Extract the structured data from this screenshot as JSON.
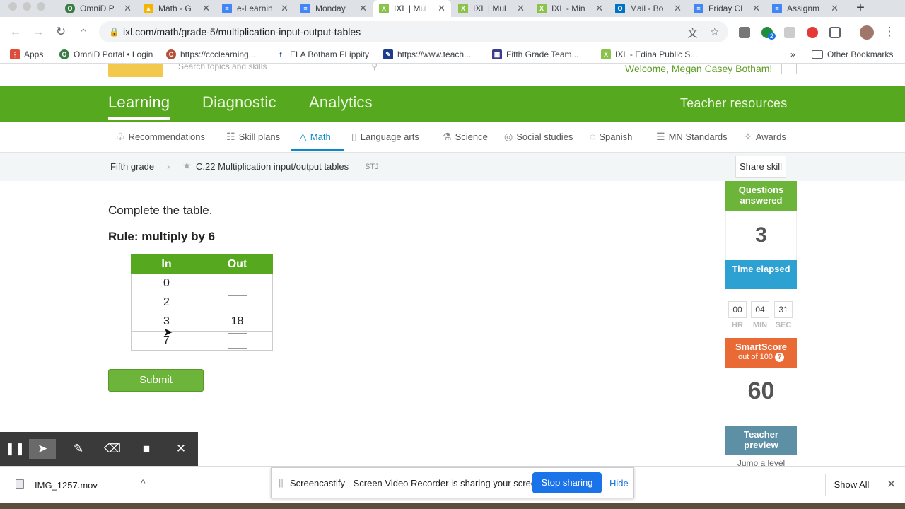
{
  "browser": {
    "tabs": [
      {
        "title": "OmniD P",
        "icon": "omnid-icon"
      },
      {
        "title": "Math - G",
        "icon": "drive-icon"
      },
      {
        "title": "e-Learnin",
        "icon": "docs-icon"
      },
      {
        "title": "Monday",
        "icon": "docs-icon"
      },
      {
        "title": "IXL | Mul",
        "icon": "ixl-icon",
        "active": true
      },
      {
        "title": "IXL | Mul",
        "icon": "ixl-icon"
      },
      {
        "title": "IXL - Min",
        "icon": "ixl-icon"
      },
      {
        "title": "Mail - Bo",
        "icon": "outlook-icon"
      },
      {
        "title": "Friday Cl",
        "icon": "docs-icon"
      },
      {
        "title": "Assignm",
        "icon": "docs-icon"
      }
    ],
    "url": "ixl.com/math/grade-5/multiplication-input-output-tables",
    "extension_badge": "2",
    "bookmarks": [
      {
        "label": "Apps"
      },
      {
        "label": "OmniD Portal • Login"
      },
      {
        "label": "https://ccclearning..."
      },
      {
        "label": "ELA Botham FLippity"
      },
      {
        "label": "https://www.teach..."
      },
      {
        "label": "Fifth Grade Team..."
      },
      {
        "label": "IXL - Edina Public S..."
      }
    ],
    "bookmarks_more": "»",
    "other_bookmarks": "Other Bookmarks"
  },
  "ixl": {
    "search_placeholder": "Search topics and skills",
    "welcome": "Welcome, Megan Casey Botham!",
    "main_nav": [
      "Learning",
      "Diagnostic",
      "Analytics"
    ],
    "teacher_resources": "Teacher resources",
    "subjects": [
      {
        "label": "Recommendations",
        "icon": "recommendations-icon"
      },
      {
        "label": "Skill plans",
        "icon": "skill-plans-icon"
      },
      {
        "label": "Math",
        "icon": "math-icon"
      },
      {
        "label": "Language arts",
        "icon": "book-icon"
      },
      {
        "label": "Science",
        "icon": "flask-icon"
      },
      {
        "label": "Social studies",
        "icon": "globe-icon"
      },
      {
        "label": "Spanish",
        "icon": "speech-icon"
      },
      {
        "label": "MN Standards",
        "icon": "standards-icon"
      },
      {
        "label": "Awards",
        "icon": "awards-icon"
      }
    ],
    "breadcrumb": {
      "grade": "Fifth grade",
      "skill": "C.22 Multiplication input/output tables",
      "code": "STJ"
    },
    "share_skill": "Share skill"
  },
  "question": {
    "instruction": "Complete the table.",
    "rule": "Rule: multiply by 6",
    "headers": [
      "In",
      "Out"
    ],
    "rows": [
      {
        "in": "0",
        "out": ""
      },
      {
        "in": "2",
        "out": ""
      },
      {
        "in": "3",
        "out": "18"
      },
      {
        "in": "7",
        "out": ""
      }
    ],
    "submit": "Submit"
  },
  "stats": {
    "questions_answered_label": "Questions answered",
    "questions_answered": "3",
    "time_elapsed_label": "Time elapsed",
    "time": {
      "hr": "00",
      "min": "04",
      "sec": "31"
    },
    "time_units": {
      "hr": "HR",
      "min": "MIN",
      "sec": "SEC"
    },
    "smartscore_label": "SmartScore",
    "smartscore_sub": "out of 100",
    "smartscore_help": "?",
    "smartscore": "60",
    "teacher_preview": "Teacher preview",
    "jump_level": "Jump a level"
  },
  "screencastify": {
    "message": "Screencastify - Screen Video Recorder is sharing your screen.",
    "stop": "Stop sharing",
    "hide": "Hide"
  },
  "downloads": {
    "file": "IMG_1257.mov",
    "show_all": "Show All"
  },
  "colors": {
    "ixl_green": "#56a81f",
    "math_blue": "#0a8bc7",
    "time_blue": "#2ea1d3",
    "smartscore_orange": "#e96a35",
    "teacher_slate": "#5d8fa5"
  }
}
